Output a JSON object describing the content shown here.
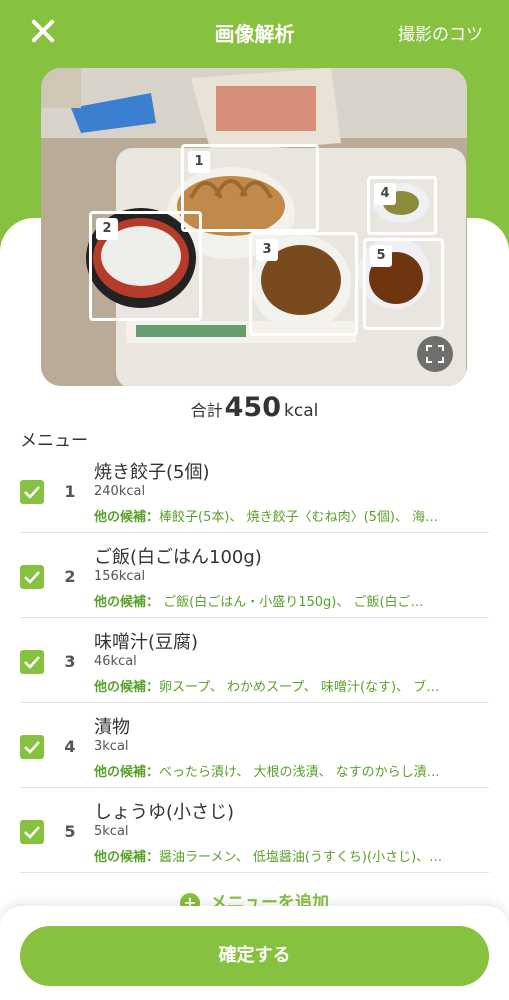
{
  "header": {
    "title": "画像解析",
    "tips_label": "撮影のコツ"
  },
  "photo": {
    "detections": [
      "1",
      "2",
      "3",
      "4",
      "5"
    ]
  },
  "total": {
    "label": "合計",
    "value": "450",
    "unit": "kcal"
  },
  "menu": {
    "heading": "メニュー",
    "items": [
      {
        "index": "1",
        "name": "焼き餃子(5個)",
        "kcal": "240kcal",
        "candidates_label": "他の候補：",
        "candidates": "棒餃子(5本)、 焼き餃子〈むね肉〉(5個)、 海…"
      },
      {
        "index": "2",
        "name": "ご飯(白ごはん100g)",
        "kcal": "156kcal",
        "candidates_label": "他の候補：",
        "candidates": " ご飯(白ごはん・小盛り150g)、 ご飯(白ご…"
      },
      {
        "index": "3",
        "name": "味噌汁(豆腐)",
        "kcal": "46kcal",
        "candidates_label": "他の候補：",
        "candidates": "卵スープ、 わかめスープ、 味噌汁(なす)、 ブ…"
      },
      {
        "index": "4",
        "name": "漬物",
        "kcal": "3kcal",
        "candidates_label": "他の候補：",
        "candidates": "べったら漬け、 大根の浅漬、 なすのからし漬…"
      },
      {
        "index": "5",
        "name": "しょうゆ(小さじ)",
        "kcal": "5kcal",
        "candidates_label": "他の候補：",
        "candidates": "醤油ラーメン、 低塩醤油(うすくち)(小さじ)、…"
      }
    ],
    "add_label": "メニューを追加"
  },
  "footer": {
    "confirm_label": "確定する"
  },
  "colors": {
    "accent": "#86c13f",
    "candidate_text": "#59a12a"
  },
  "icons": [
    "close-icon",
    "expand-icon",
    "checkmark-icon",
    "plus-icon"
  ]
}
